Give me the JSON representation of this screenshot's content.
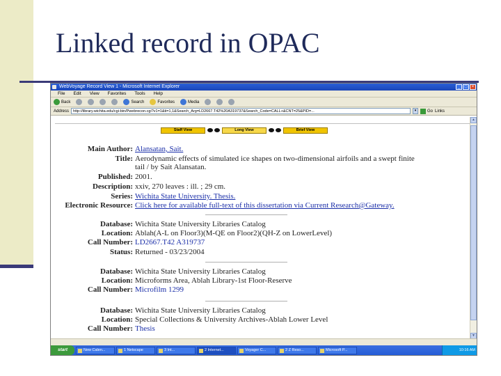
{
  "slide": {
    "title": "Linked record in OPAC"
  },
  "browser": {
    "window_title": "WebVoyage Record View 1 - Microsoft Internet Explorer",
    "menu": [
      "File",
      "Edit",
      "View",
      "Favorites",
      "Tools",
      "Help"
    ],
    "toolbar": {
      "back": "Back",
      "search": "Search",
      "favorites": "Favorites",
      "media": "Media"
    },
    "address_label": "Address",
    "address_value": "http://library.wichita.edu/cgi-bin/Pwebrecon.cgi?v1=1&ti=1,1&Search_Arg=LD2667.T42%20A319737&Search_Code=CALL+&CNT=25&PID=...",
    "go_label": "Go",
    "links_label": "Links"
  },
  "record": {
    "view_tabs": [
      "Staff View",
      "Long View",
      "Brief View"
    ],
    "fields": [
      {
        "label": "Main Author:",
        "value": "Alansatan, Sait.",
        "style": "link"
      },
      {
        "label": "Title:",
        "value": "Aerodynamic effects of simulated ice shapes on two-dimensional airfoils and a swept finite",
        "style": "plain"
      },
      {
        "label": "",
        "value": "tail / by Sait Alansatan.",
        "style": "plain"
      },
      {
        "label": "Published:",
        "value": "2001.",
        "style": "plain"
      },
      {
        "label": "Description:",
        "value": "xxiv, 270 leaves : ill. ; 29 cm.",
        "style": "plain"
      },
      {
        "label": "Series:",
        "value": "Wichita State University. Thesis.",
        "style": "link"
      },
      {
        "label": "Electronic Resource:",
        "value": "Click here for available full-text of this dissertation via Current Research@Gateway.",
        "style": "link"
      }
    ],
    "holdings": [
      {
        "database_label": "Database:",
        "database": "Wichita State University Libraries Catalog",
        "location_label": "Location:",
        "location": "Ablah(A-L on Floor3)(M-QE on Floor2)(QH-Z on LowerLevel)",
        "call_label": "Call Number:",
        "call": "LD2667.T42 A319737",
        "status_label": "Status:",
        "status": "Returned - 03/23/2004"
      },
      {
        "database_label": "Database:",
        "database": "Wichita State University Libraries Catalog",
        "location_label": "Location:",
        "location": "Microforms Area, Ablah Library-1st Floor-Reserve",
        "call_label": "Call Number:",
        "call": "Microfilm 1299"
      },
      {
        "database_label": "Database:",
        "database": "Wichita State University Libraries Catalog",
        "location_label": "Location:",
        "location": "Special Collections & University Archives-Ablah Lower Level",
        "call_label": "Call Number:",
        "call": "Thesis"
      }
    ]
  },
  "taskbar": {
    "start": "start",
    "tasks": [
      "New Calen...",
      "1 Netscape",
      "3 Int...",
      "2 Internet...",
      "Voyager C...",
      "2 Z Reso...",
      "Microsoft P..."
    ],
    "tray_time": "10:16 AM"
  },
  "colors": {
    "slide_accent": "#3a3a78",
    "slide_bar": "#ecebc7",
    "title_text": "#1f2a5a",
    "link": "#1a2ea8",
    "tab_yellow": "#f0c400"
  }
}
